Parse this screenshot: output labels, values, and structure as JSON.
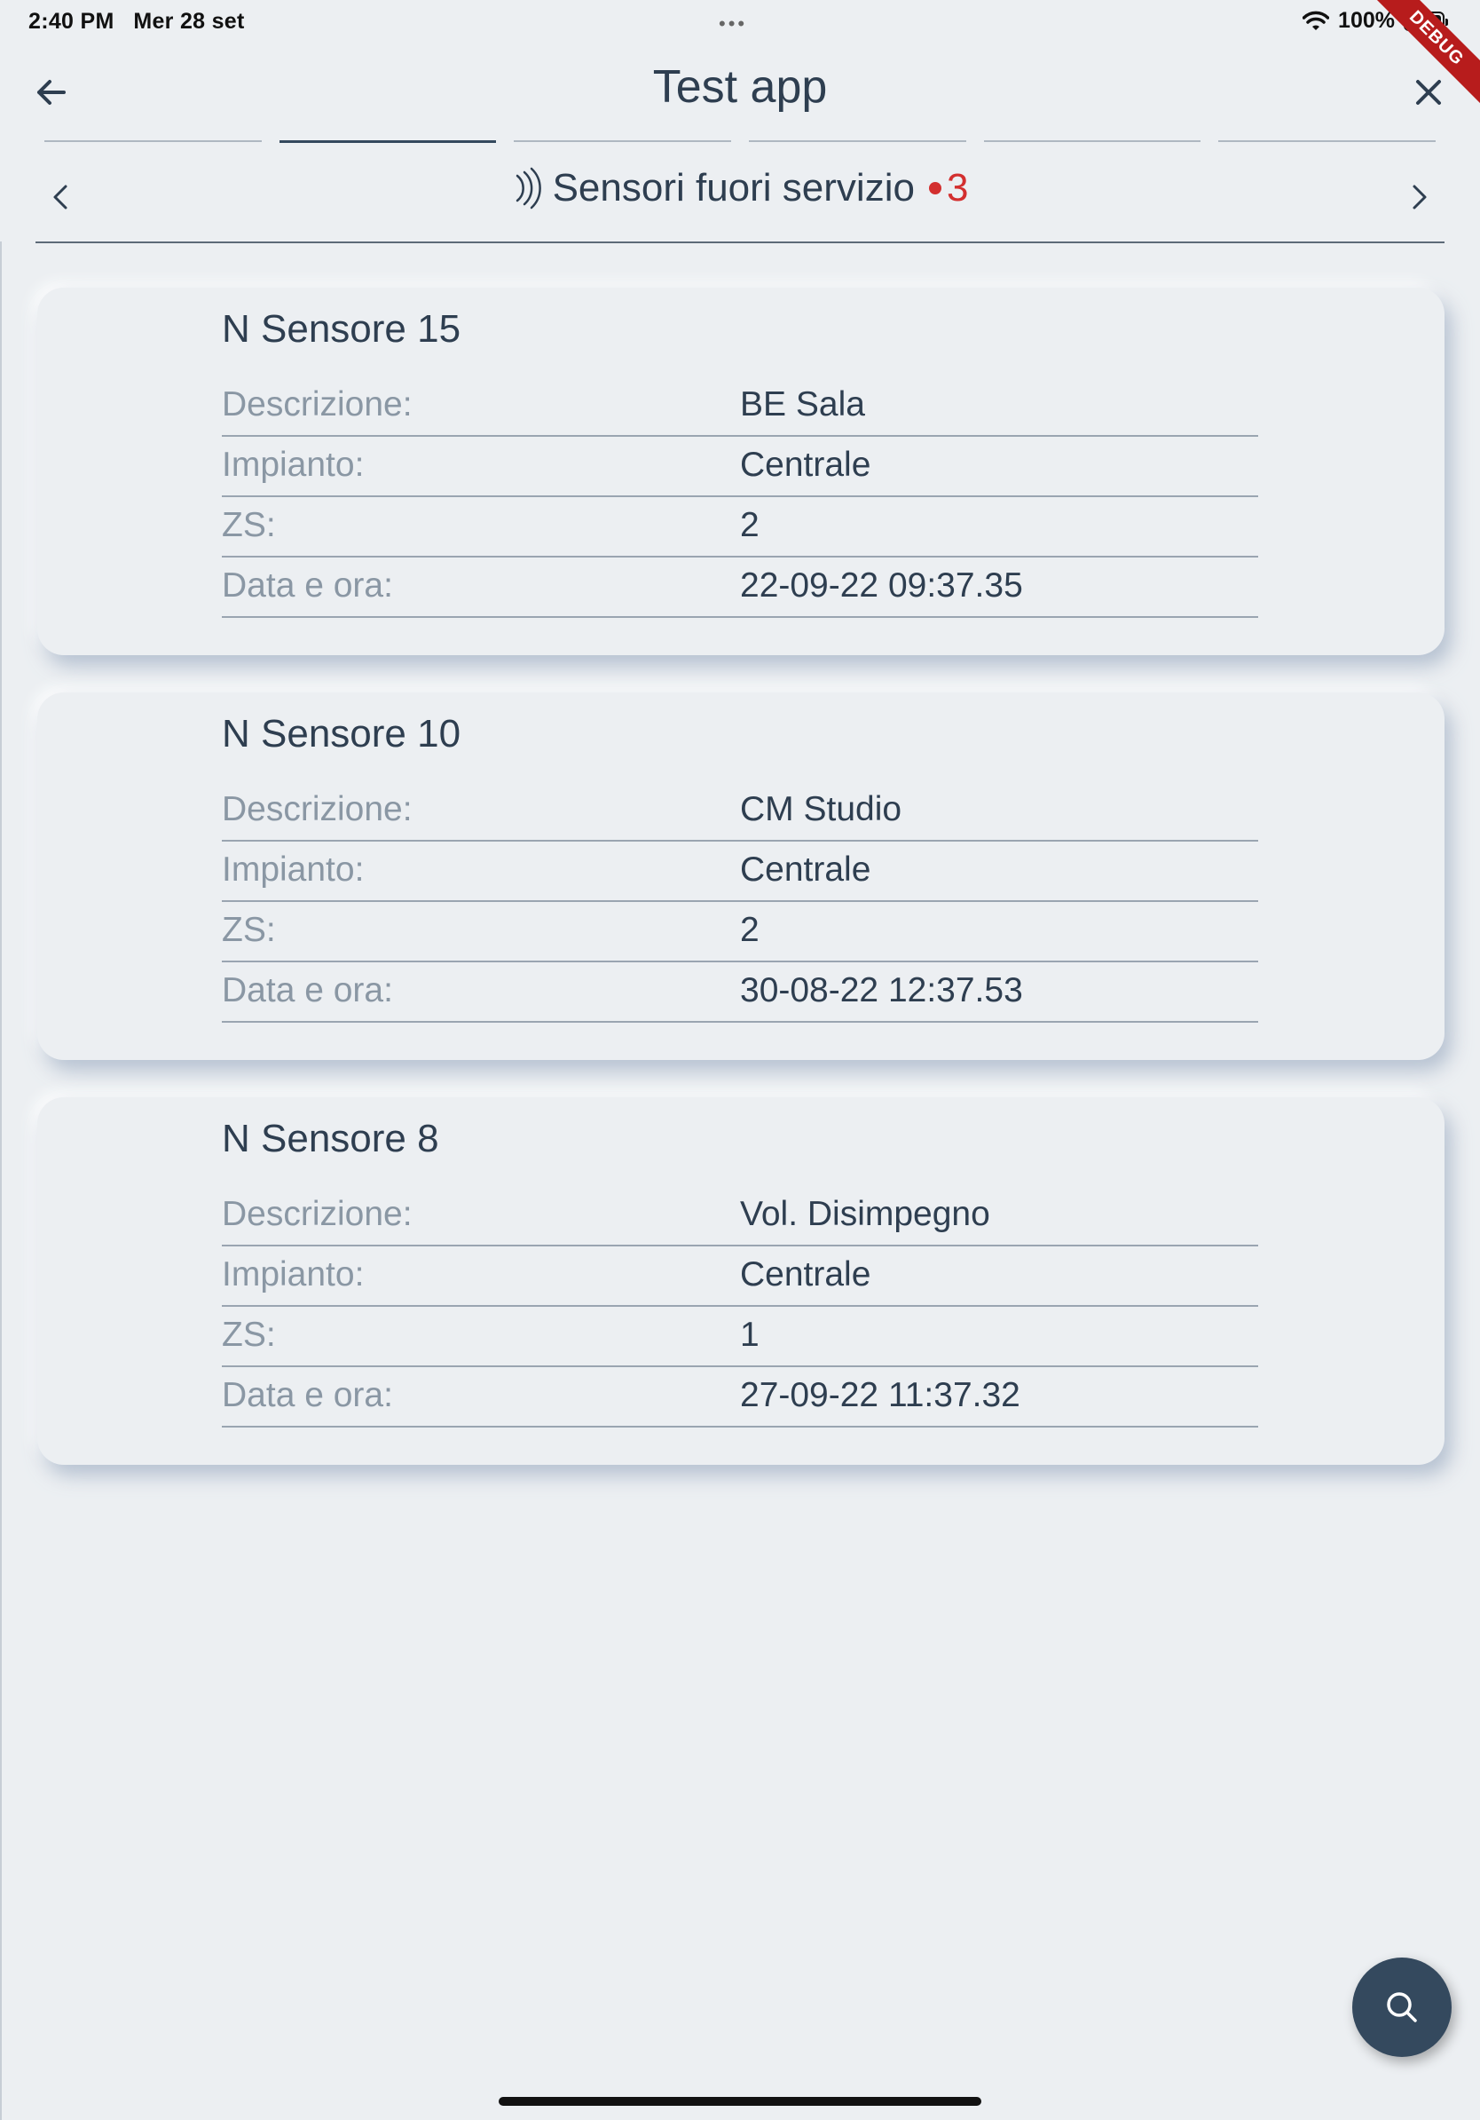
{
  "status_bar": {
    "time": "2:40 PM",
    "date": "Mer 28 set",
    "battery": "100%",
    "debug_label": "DEBUG"
  },
  "app_bar": {
    "title": "Test app",
    "back_icon": "arrow-left-icon",
    "close_icon": "close-icon"
  },
  "tabs": {
    "count": 6,
    "active_index": 1
  },
  "section": {
    "title": "Sensori fuori servizio",
    "badge_count": "3",
    "icon": "signal-waves-icon",
    "badge_color": "#D32F2F"
  },
  "sensors": [
    {
      "title": "N Sensore 15",
      "rows": [
        {
          "label": "Descrizione:",
          "value": "BE Sala"
        },
        {
          "label": "Impianto:",
          "value": "Centrale"
        },
        {
          "label": "ZS:",
          "value": "2"
        },
        {
          "label": "Data e ora:",
          "value": "22-09-22 09:37.35"
        }
      ]
    },
    {
      "title": "N Sensore 10",
      "rows": [
        {
          "label": "Descrizione:",
          "value": "CM Studio"
        },
        {
          "label": "Impianto:",
          "value": "Centrale"
        },
        {
          "label": "ZS:",
          "value": "2"
        },
        {
          "label": "Data e ora:",
          "value": "30-08-22 12:37.53"
        }
      ]
    },
    {
      "title": "N Sensore 8",
      "rows": [
        {
          "label": "Descrizione:",
          "value": "Vol. Disimpegno"
        },
        {
          "label": "Impianto:",
          "value": "Centrale"
        },
        {
          "label": "ZS:",
          "value": "1"
        },
        {
          "label": "Data e ora:",
          "value": "27-09-22 11:37.32"
        }
      ]
    }
  ],
  "fab": {
    "icon": "search-icon"
  },
  "colors": {
    "background": "#ECEFF2",
    "primary": "#34495E",
    "accent_red": "#D32F2F"
  }
}
